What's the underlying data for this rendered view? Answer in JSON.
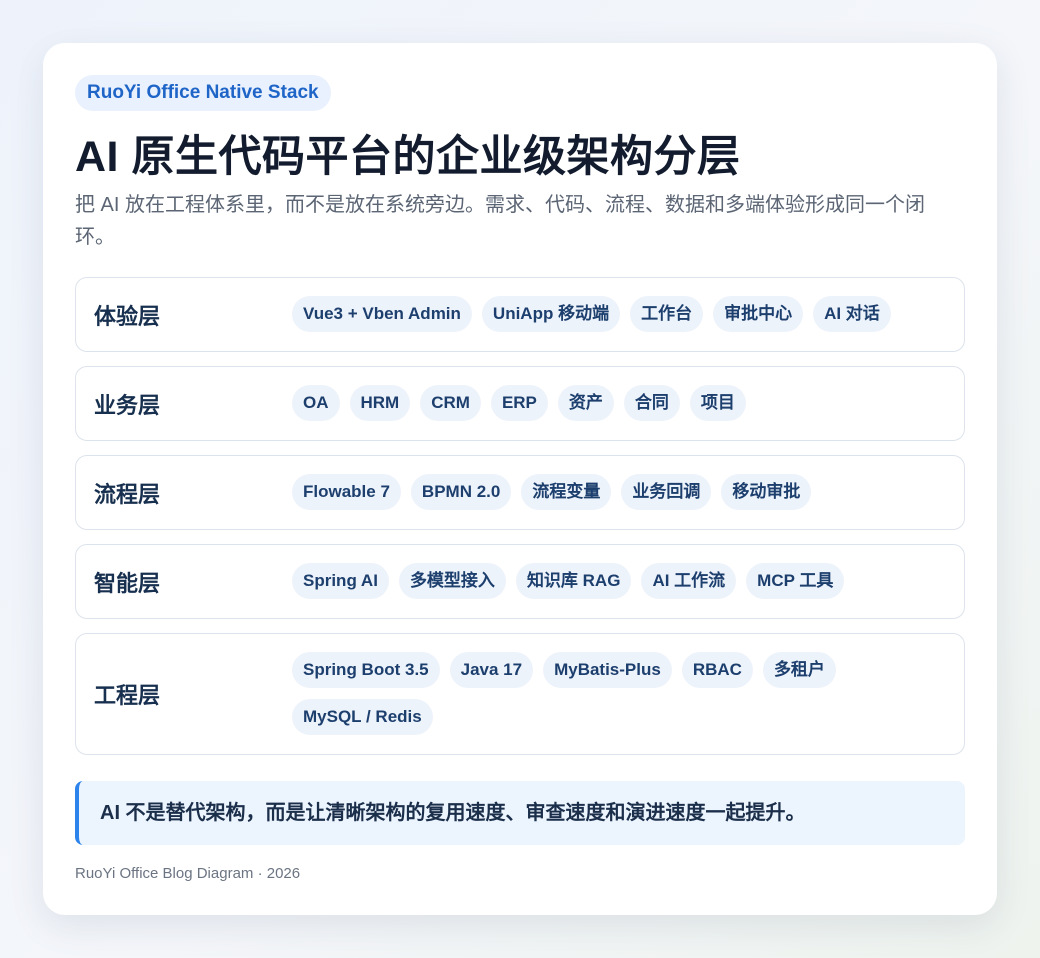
{
  "badge": "RuoYi Office Native Stack",
  "title": "AI 原生代码平台的企业级架构分层",
  "subtitle": "把 AI 放在工程体系里，而不是放在系统旁边。需求、代码、流程、数据和多端体验形成同一个闭环。",
  "layers": [
    {
      "name": "体验层",
      "tags": [
        "Vue3 + Vben Admin",
        "UniApp 移动端",
        "工作台",
        "审批中心",
        "AI 对话"
      ]
    },
    {
      "name": "业务层",
      "tags": [
        "OA",
        "HRM",
        "CRM",
        "ERP",
        "资产",
        "合同",
        "项目"
      ]
    },
    {
      "name": "流程层",
      "tags": [
        "Flowable 7",
        "BPMN 2.0",
        "流程变量",
        "业务回调",
        "移动审批"
      ]
    },
    {
      "name": "智能层",
      "tags": [
        "Spring AI",
        "多模型接入",
        "知识库 RAG",
        "AI 工作流",
        "MCP 工具"
      ]
    },
    {
      "name": "工程层",
      "tags": [
        "Spring Boot 3.5",
        "Java 17",
        "MyBatis-Plus",
        "RBAC",
        "多租户",
        "MySQL / Redis"
      ]
    }
  ],
  "note": "AI 不是替代架构，而是让清晰架构的复用速度、审查速度和演进速度一起提升。",
  "footer": "RuoYi Office Blog Diagram · 2026",
  "colors": {
    "accent": "#2c83ec",
    "badge_text": "#1f65c8",
    "tag_bg": "#edf3fb",
    "note_bg": "#ecf4fd"
  }
}
